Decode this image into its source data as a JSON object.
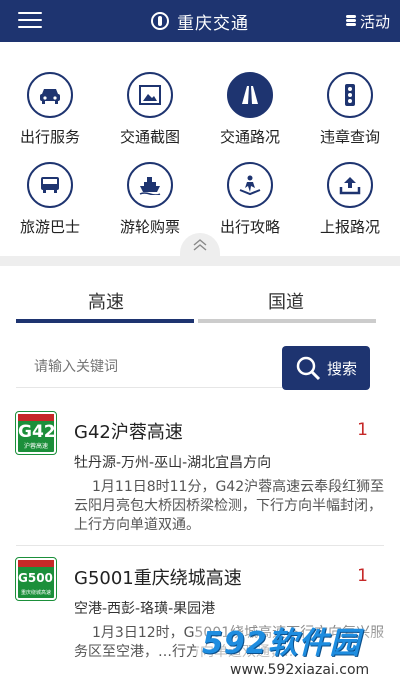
{
  "header": {
    "title": "重庆交通",
    "activity_label": "活动"
  },
  "services": [
    {
      "label": "出行服务",
      "icon": "car-icon"
    },
    {
      "label": "交通截图",
      "icon": "picture-icon"
    },
    {
      "label": "交通路况",
      "icon": "road-icon"
    },
    {
      "label": "违章查询",
      "icon": "traffic-light-icon"
    },
    {
      "label": "旅游巴士",
      "icon": "bus-icon"
    },
    {
      "label": "游轮购票",
      "icon": "ship-icon"
    },
    {
      "label": "出行攻略",
      "icon": "guide-book-icon"
    },
    {
      "label": "上报路况",
      "icon": "upload-icon"
    }
  ],
  "tabs": {
    "highway": "高速",
    "national": "国道",
    "active": "highway"
  },
  "search": {
    "placeholder": "请输入关键词",
    "button_label": "搜索"
  },
  "roads": [
    {
      "sign_code": "G42",
      "sign_sub": "沪蓉高速",
      "name": "G42沪蓉高速",
      "count": "1",
      "route": "牡丹源-万州-巫山-湖北宜昌方向",
      "description": "1月11日8时11分，G42沪蓉高速云奉段红狮至云阳月亮包大桥因桥梁检测，下行方向半幅封闭，上行方向单道双通。"
    },
    {
      "sign_code": "G5001",
      "sign_sub": "重庆绕城高速",
      "name": "G5001重庆绕城高速",
      "count": "1",
      "route": "空港-西彭-珞璜-果园港",
      "description": "1月3日12时，G5001绕城高速下行方向复兴服务区至空港，…行方向单道双通，…"
    }
  ],
  "watermark": {
    "brand": "592软件园",
    "url": "www.592xiazai.com"
  },
  "colors": {
    "primary": "#1e3470",
    "accent_red": "#c62828",
    "sign_green": "#1b8f3a",
    "tab_inactive": "#cccccc"
  }
}
